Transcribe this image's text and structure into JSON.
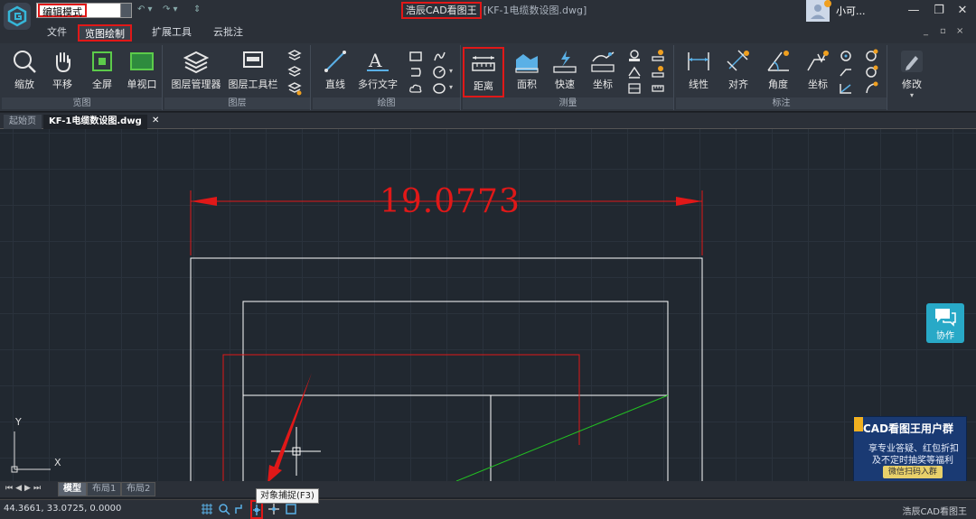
{
  "titlebar": {
    "mode": "编辑模式",
    "app_name": "浩辰CAD看图王",
    "file_title": "[KF-1电缆数设图.dwg]",
    "username": "小可...",
    "window_controls": [
      "—",
      "❐",
      "✕"
    ]
  },
  "menu": {
    "tabs": [
      {
        "label": "文件",
        "active": false
      },
      {
        "label": "览图绘制",
        "active": true
      },
      {
        "label": "扩展工具",
        "active": false
      },
      {
        "label": "云批注",
        "active": false
      }
    ],
    "mdi_controls": [
      "_",
      "▫",
      "×"
    ]
  },
  "ribbon": {
    "groups": {
      "view": "览图",
      "layer": "图层",
      "draw": "绘图",
      "measure": "测量",
      "annotate": "标注"
    },
    "tools": {
      "zoom": "缩放",
      "pan": "平移",
      "fullscreen": "全屏",
      "single_viewport": "单视口",
      "layer_manager": "图层管理器",
      "layer_toolbar": "图层工具栏",
      "line": "直线",
      "mtext": "多行文字",
      "distance": "距离",
      "area": "面积",
      "quick": "快速",
      "coordinate": "坐标",
      "linear": "线性",
      "aligned": "对齐",
      "angle": "角度",
      "dim_coordinate": "坐标",
      "modify": "修改"
    }
  },
  "doc_tabs": [
    {
      "label": "起始页",
      "active": false
    },
    {
      "label": "KF-1电缆数设图.dwg",
      "active": true
    }
  ],
  "canvas": {
    "dimension_value": "19.0773",
    "collab_label": "协作",
    "promo": {
      "title": "CAD看图王用户群",
      "line1": "享专业答疑、红包折扣",
      "line2": "及不定时抽奖等福利",
      "button": "微信扫码入群"
    },
    "ucs_x": "X",
    "ucs_y": "Y"
  },
  "layout_tabs": [
    {
      "label": "模型",
      "active": true
    },
    {
      "label": "布局1",
      "active": false
    },
    {
      "label": "布局2",
      "active": false
    }
  ],
  "tooltip": "对象捕捉(F3)",
  "status": {
    "coordinates": "44.3661, 33.0725, 0.0000",
    "app_name": "浩辰CAD看图王"
  },
  "colors": {
    "highlight": "#e01818",
    "dimension": "#e01818",
    "accent": "#28a9c7"
  }
}
